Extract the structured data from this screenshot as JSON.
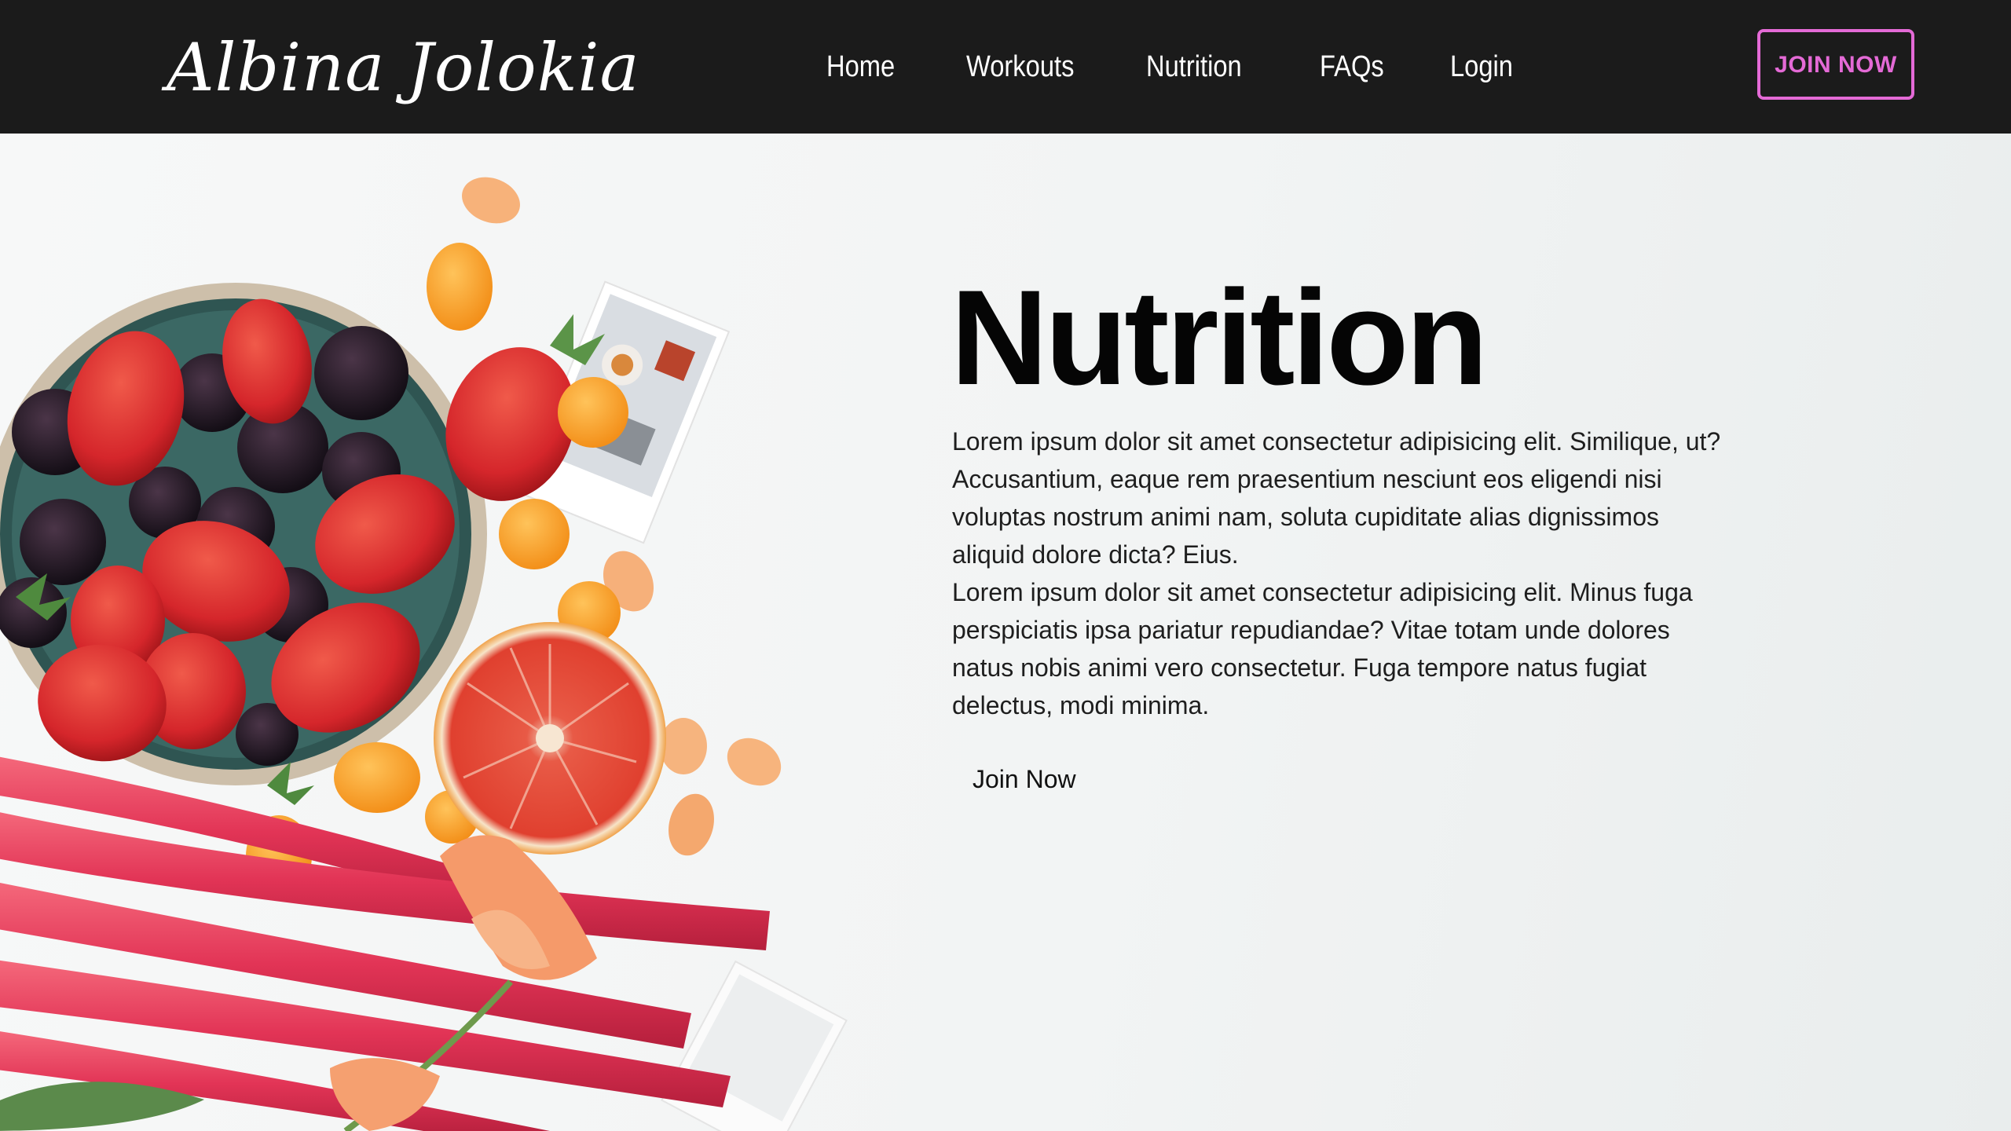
{
  "brand": {
    "logo_text": "Albina Jolokia"
  },
  "nav": {
    "items": [
      {
        "label": "Home"
      },
      {
        "label": "Workouts"
      },
      {
        "label": "Nutrition"
      },
      {
        "label": "FAQs"
      },
      {
        "label": "Login"
      }
    ],
    "cta_label": "JOIN NOW"
  },
  "hero": {
    "title": "Nutrition",
    "paragraphs": [
      "Lorem ipsum dolor sit amet consectetur adipisicing elit. Similique, ut? Accusantium, eaque rem praesentium nesciunt eos eligendi nisi voluptas nostrum animi nam, soluta cupiditate alias dignissimos aliquid dolore dicta? Eius.",
      "Lorem ipsum dolor sit amet consectetur adipisicing elit. Minus fuga perspiciatis ipsa pariatur repudiandae? Vitae totam unde dolores natus nobis animi vero consectetur. Fuga tempore natus fugiat delectus, modi minima."
    ],
    "button_label": "Join Now"
  },
  "colors": {
    "header_bg": "#1b1b1b",
    "accent": "#e46ad6",
    "page_bg": "#f3f5f5",
    "heading": "#050505"
  },
  "icons": {
    "hero_image": "fruit-bowl-strawberries-blackberries-grapefruit-rhubarb-image"
  }
}
